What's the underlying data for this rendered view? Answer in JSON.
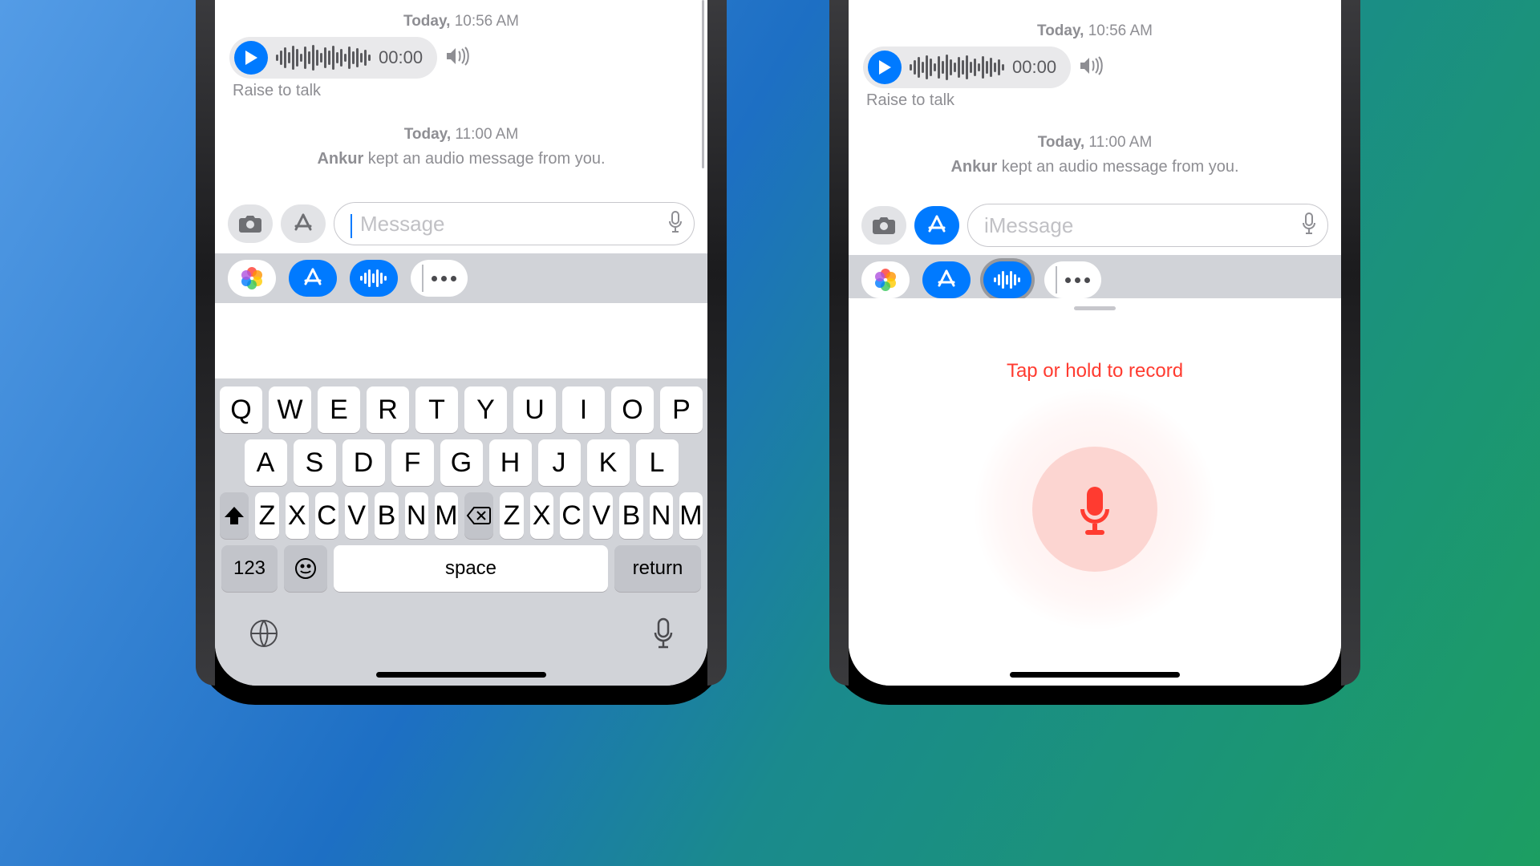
{
  "left": {
    "ts1_a": "Today,",
    "ts1_b": "10:56 AM",
    "audio_duration": "00:00",
    "raise": "Raise to talk",
    "ts2_a": "Today,",
    "ts2_b": "11:00 AM",
    "status_name": "Ankur",
    "status_rest": " kept an audio message from you.",
    "placeholder": "Message",
    "kbd": {
      "r1": [
        "Q",
        "W",
        "E",
        "R",
        "T",
        "Y",
        "U",
        "I",
        "O",
        "P"
      ],
      "r2": [
        "A",
        "S",
        "D",
        "F",
        "G",
        "H",
        "J",
        "K",
        "L"
      ],
      "r3": [
        "Z",
        "X",
        "C",
        "V",
        "B",
        "N",
        "M"
      ],
      "num": "123",
      "space": "space",
      "ret": "return"
    }
  },
  "right": {
    "ts1_a": "Today,",
    "ts1_b": "10:56 AM",
    "audio_duration": "00:00",
    "raise": "Raise to talk",
    "ts2_a": "Today,",
    "ts2_b": "11:00 AM",
    "status_name": "Ankur",
    "status_rest": " kept an audio message from you.",
    "placeholder": "iMessage",
    "rec_hint": "Tap or hold to record"
  }
}
